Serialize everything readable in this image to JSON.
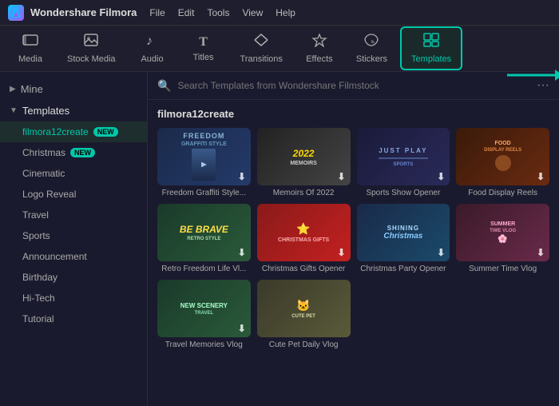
{
  "app": {
    "name": "Wondershare Filmora",
    "logo": "F",
    "menu": [
      "File",
      "Edit",
      "Tools",
      "View",
      "Help"
    ]
  },
  "toolbar": {
    "items": [
      {
        "id": "media",
        "label": "Media",
        "icon": "🎬"
      },
      {
        "id": "stock",
        "label": "Stock Media",
        "icon": "📷"
      },
      {
        "id": "audio",
        "label": "Audio",
        "icon": "🎵"
      },
      {
        "id": "titles",
        "label": "Titles",
        "icon": "T"
      },
      {
        "id": "transitions",
        "label": "Transitions",
        "icon": "⬦"
      },
      {
        "id": "effects",
        "label": "Effects",
        "icon": "✦"
      },
      {
        "id": "stickers",
        "label": "Stickers",
        "icon": "🎀"
      },
      {
        "id": "templates",
        "label": "Templates",
        "icon": "⊞",
        "active": true
      }
    ]
  },
  "sidebar": {
    "mine_label": "Mine",
    "templates_label": "Templates",
    "items": [
      {
        "id": "filmora12create",
        "label": "filmora12create",
        "badge": "NEW",
        "active": true
      },
      {
        "id": "christmas",
        "label": "Christmas",
        "badge": "NEW"
      },
      {
        "id": "cinematic",
        "label": "Cinematic"
      },
      {
        "id": "logo-reveal",
        "label": "Logo Reveal"
      },
      {
        "id": "travel",
        "label": "Travel"
      },
      {
        "id": "sports",
        "label": "Sports"
      },
      {
        "id": "announcement",
        "label": "Announcement"
      },
      {
        "id": "birthday",
        "label": "Birthday"
      },
      {
        "id": "hi-tech",
        "label": "Hi-Tech"
      },
      {
        "id": "tutorial",
        "label": "Tutorial"
      }
    ]
  },
  "search": {
    "placeholder": "Search Templates from Wondershare Filmstock"
  },
  "content": {
    "section_title": "filmora12create",
    "templates": [
      {
        "id": "freedom-graffiti",
        "name": "Freedom Graffiti Style...",
        "style": "freedom"
      },
      {
        "id": "memoirs-2022",
        "name": "Memoirs Of 2022",
        "style": "memoirs"
      },
      {
        "id": "sports-opener",
        "name": "Sports Show Opener",
        "style": "sports"
      },
      {
        "id": "food-reels",
        "name": "Food Display Reels",
        "style": "food"
      },
      {
        "id": "retro-freedom",
        "name": "Retro Freedom Life Vl...",
        "style": "retro"
      },
      {
        "id": "christmas-gifts",
        "name": "Christmas Gifts Opener",
        "style": "xmas"
      },
      {
        "id": "christmas-party",
        "name": "Christmas Party Opener",
        "style": "xmas-party"
      },
      {
        "id": "summer-vlog",
        "name": "Summer Time Vlog",
        "style": "summer"
      },
      {
        "id": "travel-memories",
        "name": "Travel Memories Vlog",
        "style": "travel"
      },
      {
        "id": "cute-pet",
        "name": "Cute Pet Daily Vlog",
        "style": "pet"
      }
    ]
  }
}
